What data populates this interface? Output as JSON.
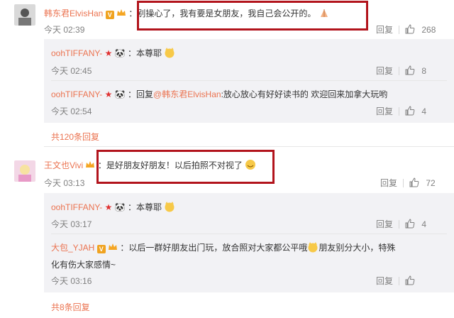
{
  "comments": [
    {
      "user": "韩东君ElvisHan",
      "text": "：别操心了，我有要是女朋友，我自己会公开的。",
      "time": "今天 02:39",
      "reply_label": "回复",
      "likes": "268"
    },
    {
      "user": "王文也Vivi",
      "text": "：是好朋友好朋友！以后拍照不对视了",
      "time": "今天 03:13",
      "reply_label": "回复",
      "likes": "72"
    }
  ],
  "replies_1": [
    {
      "user": "oohTIFFANY-",
      "text": "：本尊耶",
      "time": "今天 02:45",
      "reply_label": "回复",
      "likes": "8"
    },
    {
      "user": "oohTIFFANY-",
      "text_prefix": "：回复",
      "mention": "@韩东君ElvisHan",
      "text": ":放心放心有好好读书的 欢迎回来加拿大玩哟",
      "time": "今天 02:54",
      "reply_label": "回复",
      "likes": "4"
    }
  ],
  "replies_1_more": "共120条回复",
  "replies_2": [
    {
      "user": "oohTIFFANY-",
      "text": "：本尊耶",
      "time": "今天 03:17",
      "reply_label": "回复",
      "likes": "4"
    },
    {
      "user": "大包_YJAH",
      "text_line1": "：以后一群好朋友出门玩，放合照对大家都公平哦",
      "text_line1b": "朋友别分大小，特殊",
      "text_line2": "化有伤大家感情~",
      "time": "今天 03:16",
      "reply_label": "回复",
      "likes": ""
    }
  ],
  "replies_2_more": "共8条回复",
  "colors": {
    "link": "#eb7350",
    "highlight_box": "#b2141c",
    "reply_bg": "#f2f2f5"
  }
}
